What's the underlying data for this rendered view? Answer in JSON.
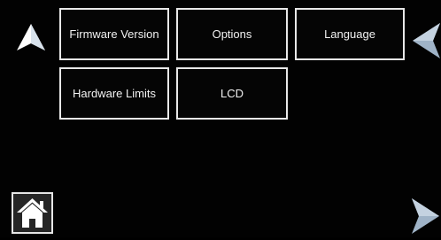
{
  "menu": {
    "firmware_version": "Firmware Version",
    "options": "Options",
    "language": "Language",
    "hardware_limits": "Hardware Limits",
    "lcd": "LCD"
  },
  "icons": {
    "up": "up-arrow-icon",
    "back": "left-arrow-icon",
    "next": "right-arrow-icon",
    "home": "home-icon"
  },
  "colors": {
    "background": "#000000",
    "button_border": "#e8e8e8",
    "button_text": "#f2f2f2",
    "arrow_fill": "#b9c8d8"
  }
}
